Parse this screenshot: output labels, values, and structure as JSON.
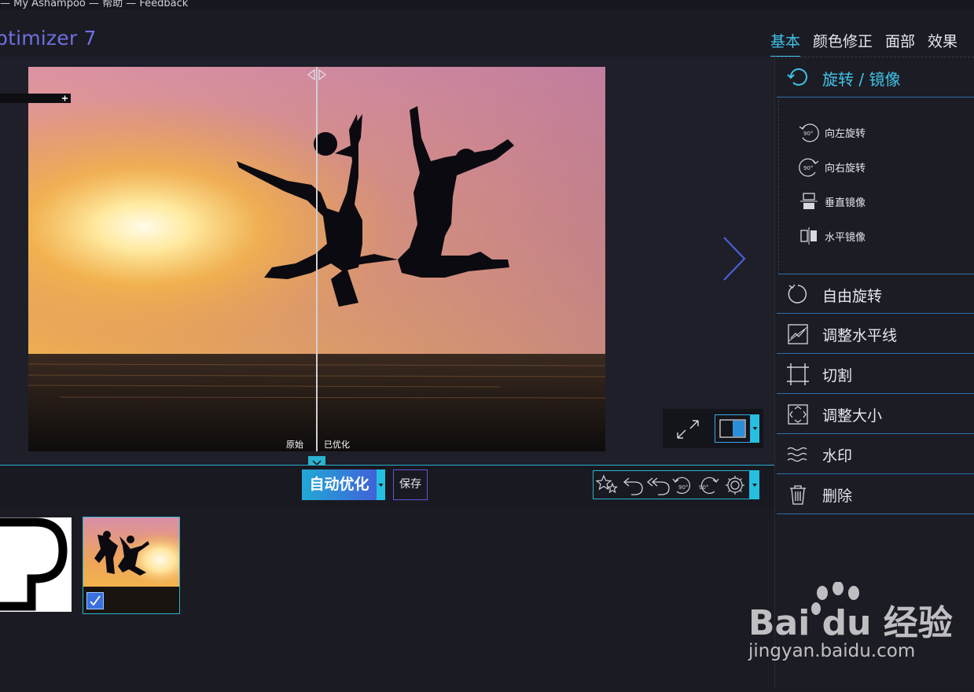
{
  "title_bar": {
    "text": "— My Ashampoo — 帮助 — Feedback"
  },
  "app": {
    "title": "ptimizer 7"
  },
  "tabs": [
    "基本",
    "颜色修正",
    "面部",
    "效果"
  ],
  "active_tab": "基本",
  "preview": {
    "label_original": "原始",
    "label_optimized": "已优化",
    "zoom_icon": "plus-icon"
  },
  "toolbar": {
    "auto_label": "自动优化",
    "save_label": "保存",
    "tools": [
      "stars-icon",
      "undo-icon",
      "undo-all-icon",
      "rotate-left-90-icon",
      "rotate-right-90-icon",
      "settings-icon"
    ]
  },
  "filmstrip": {
    "items": [
      {
        "name": "logo-thumbnail",
        "selected": false
      },
      {
        "name": "photo-thumbnail",
        "selected": true
      }
    ]
  },
  "right_panel": {
    "header": "旋转 / 镜像",
    "sub_items": [
      "向左旋转",
      "向右旋转",
      "垂直镜像",
      "水平镜像"
    ],
    "sub_icon_text": [
      "90°",
      "90°"
    ],
    "items": [
      "自由旋转",
      "调整水平线",
      "切割",
      "调整大小",
      "水印",
      "删除"
    ]
  },
  "watermark": {
    "text": "Bai du 经验",
    "url": "jingyan.baidu.com"
  },
  "colors": {
    "accent": "#2bb3d2",
    "title": "#6f6fe0",
    "active_tab": "#3fc3e6"
  }
}
